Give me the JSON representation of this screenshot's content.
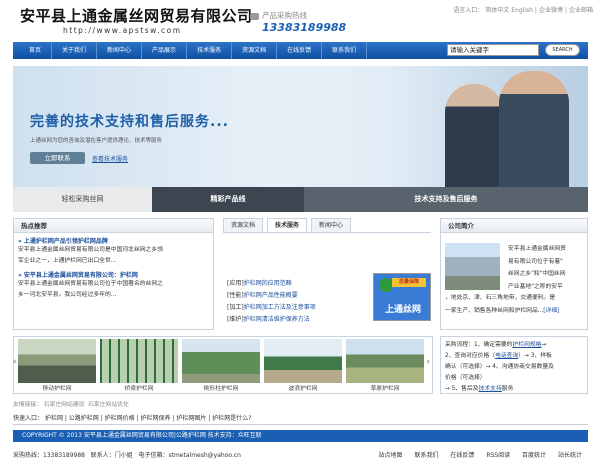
{
  "header": {
    "logo": "安平县上通金属丝网贸易有限公司",
    "url": "http://www.apstsw.com",
    "hotline_label": "产品采购热线",
    "hotline_number": "13383189988",
    "lang_label": "语言入口：",
    "links": [
      "简体中文",
      "English",
      "|",
      "企业微博",
      "|",
      "企业邮箱"
    ]
  },
  "nav": [
    "首页",
    "关于我们",
    "新闻中心",
    "产品展示",
    "技术服务",
    "资源文档",
    "在线反馈",
    "联系我们"
  ],
  "search": {
    "value": "请输入关键字",
    "button": "SEARCH"
  },
  "banner": {
    "headline": "完善的技术支持和售后服务...",
    "subtitle": "上通丝网为您的咨询及潜在客户提供理论、技术等服务",
    "button": "立即联系",
    "link": "查看技术服务"
  },
  "sections": {
    "tab1": "轻松采购丝网",
    "tab2": "精彩产品线",
    "tab3": "技术支持及售后服务"
  },
  "hot": {
    "title": "热点推荐",
    "items": [
      {
        "title": "上通护栏网产品引领护栏网品牌",
        "desc": [
          "安平县上通金属丝网贸易有限公司是中国河北丝网之乡领",
          "军企业之一，上通护栏网已出口全世..."
        ]
      },
      {
        "title": "安平县上通金属丝网贸易有限公司：护栏网",
        "desc": [
          "安平县上通金属丝网贸易有限公司位于中国著名的丝网之",
          "乡一河北安平县。我公司经过多年的..."
        ]
      }
    ]
  },
  "mid": {
    "tabs": [
      "资源文档",
      "技术服务",
      "新闻中心"
    ],
    "list": [
      {
        "tag": "[应用]",
        "text": "护栏网的应用范畴"
      },
      {
        "tag": "[性能]",
        "text": "护栏网产品性能概要"
      },
      {
        "tag": "[加工]",
        "text": "护栏网加工方法及注意事项"
      },
      {
        "tag": "[维护]",
        "text": "护栏网清洁维护保养方法"
      }
    ],
    "img": {
      "badge1": "准出",
      "badge2": "质量保障",
      "brand": "上通丝网"
    }
  },
  "company": {
    "title": "公司简介",
    "text1": [
      "安平县上通金属丝网贸",
      "易有限公司位于有着\"",
      "丝网之乡\"和\"中国丝网",
      "产业基地\"之称的安平"
    ],
    "text2": [
      "，地处京、津、石三角地带，交通便利。是",
      "一家生产、销售各种丝网和护栏网品..."
    ],
    "more": "[详细]"
  },
  "strip": [
    "移动护栏网",
    "桥梁护栏网",
    "桃形柱护栏网",
    "波浪护栏网",
    "草原护栏网"
  ],
  "process": {
    "lines": [
      [
        "采购流程：",
        "1、确定需要的",
        "护栏网规格",
        "→"
      ],
      [
        "2、查询对应价格（",
        "电话查询",
        "）→ 3、样板"
      ],
      [
        "确认（可选择）→ 4、沟通协商交易数量及"
      ],
      [
        "价格（可选择）"
      ],
      [
        "→ 5、售后及",
        "技术支持",
        "服务"
      ]
    ]
  },
  "friends": {
    "label": "友情链接：",
    "items": [
      "石家庄网站建设",
      "石家庄网站优化"
    ]
  },
  "quick": {
    "label": "快速入口：",
    "items": [
      "护栏网",
      "公路护栏网",
      "护栏网价格",
      "护栏网保养",
      "护栏网图片",
      "护栏网是什么?"
    ]
  },
  "copyright": "COPYRIGHT © 2013 安平县上通金属丝网贸易有限公司|公路护栏网      技术支持：众旺互联",
  "footer": {
    "hotline": "采购热线：13383189988",
    "contact": "联系人：门小姐",
    "email": "电子信箱：stmetalmesh@yahoo.cn",
    "links": [
      "站点地图",
      "联系我们",
      "在线反馈",
      "RSS阅读",
      "百度统计",
      "站长统计"
    ]
  },
  "colors": {
    "accent": "#1a5fb4",
    "link": "#1a4f9c"
  }
}
